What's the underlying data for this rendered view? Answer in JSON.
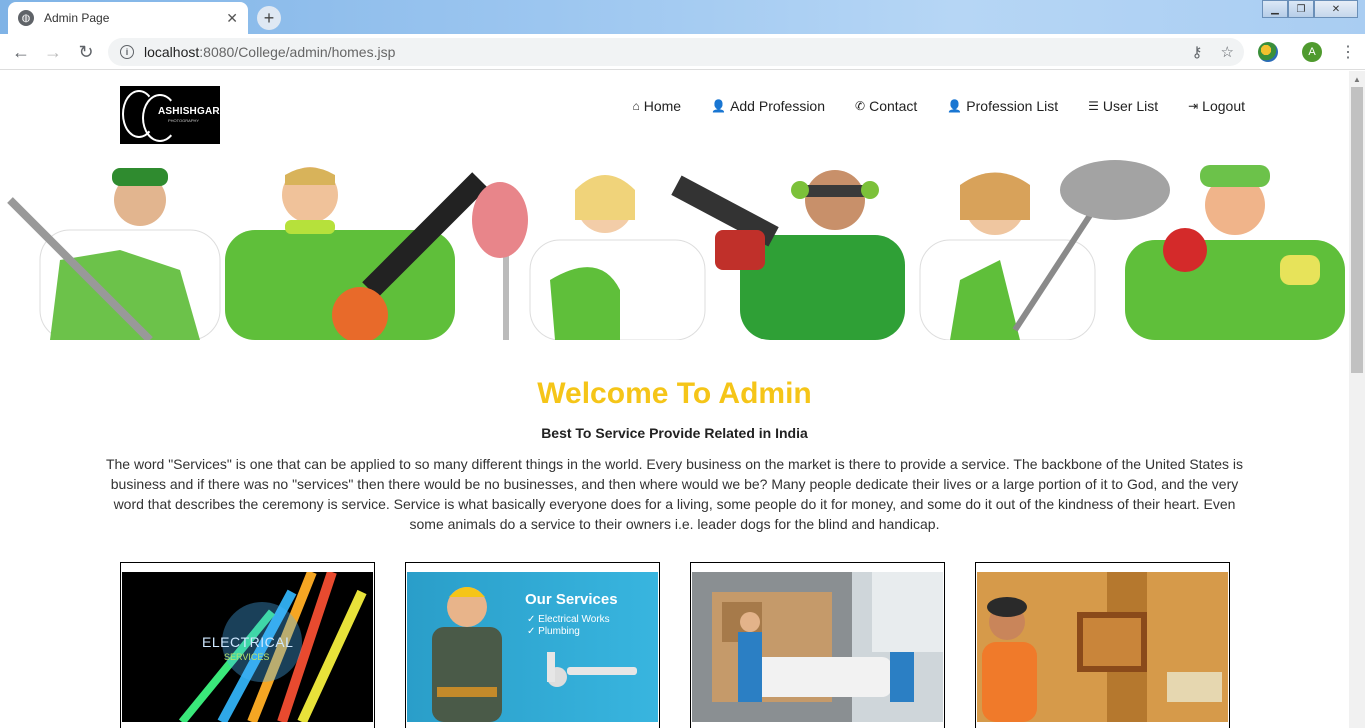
{
  "browser": {
    "tab_title": "Admin Page",
    "tab_close": "✕",
    "new_tab": "+",
    "url_host": "localhost",
    "url_rest": ":8080/College/admin/homes.jsp",
    "avatar_letter": "A",
    "window_minimize": "▁",
    "window_restore": "❐",
    "window_close": "✕"
  },
  "site": {
    "logo_text": "ASHISHGARG",
    "logo_sub": "PHOTOGRAPHY",
    "nav": [
      {
        "label": "Home",
        "icon": "home-icon",
        "glyph": "⌂"
      },
      {
        "label": "Add Profession",
        "icon": "user-icon",
        "glyph": "👤"
      },
      {
        "label": "Contact",
        "icon": "phone-icon",
        "glyph": "✆"
      },
      {
        "label": "Profession List",
        "icon": "user-icon",
        "glyph": "👤"
      },
      {
        "label": "User List",
        "icon": "list-icon",
        "glyph": "☰"
      },
      {
        "label": "Logout",
        "icon": "logout-icon",
        "glyph": "⇥"
      }
    ]
  },
  "content": {
    "welcome": "Welcome To Admin",
    "tagline": "Best To Service Provide Related in India",
    "paragraph": "The word \"Services\" is one that can be applied to so many different things in the world. Every business on the market is there to provide a service. The backbone of the United States is business and if there was no \"services\" then there would be no businesses, and then where would we be? Many people dedicate their lives or a large portion of it to God, and the very word that describes the ceremony is service. Service is what basically everyone does for a living, some people do it for money, and some do it out of the kindness of their heart. Even some animals do a service to their owners i.e. leader dogs for the blind and handicap."
  },
  "cards": [
    {
      "title": "ELECTRICAL",
      "subtitle": "SERVICES"
    },
    {
      "title": "Our Services",
      "lines": [
        "✓ Electrical Works",
        "✓ Plumbing"
      ]
    },
    {
      "title": ""
    },
    {
      "title": ""
    }
  ],
  "colors": {
    "welcome": "#f5c518",
    "green": "#5fbf3a"
  }
}
